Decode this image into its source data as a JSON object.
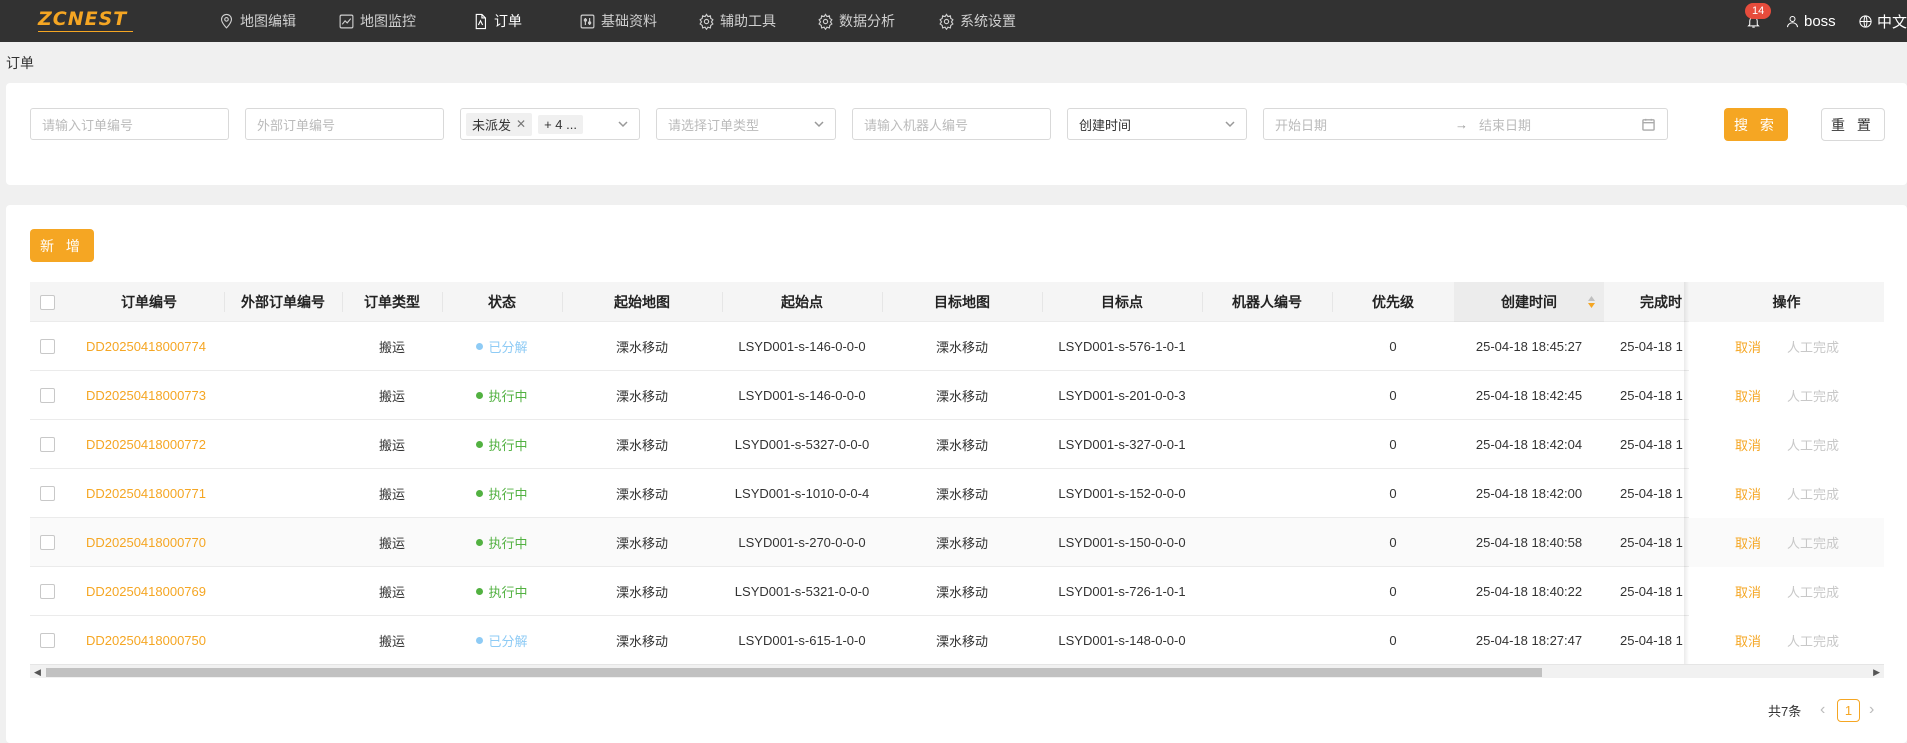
{
  "brand": {
    "logo": "ZCNEST",
    "accent": "#f5a623"
  },
  "nav": [
    {
      "label": "地图编辑",
      "icon": "map-pin-icon"
    },
    {
      "label": "地图监控",
      "icon": "chart-icon"
    },
    {
      "label": "订单",
      "icon": "document-icon",
      "active": true
    },
    {
      "label": "基础资料",
      "icon": "sliders-icon"
    },
    {
      "label": "辅助工具",
      "icon": "gear-icon"
    },
    {
      "label": "数据分析",
      "icon": "gear-icon"
    },
    {
      "label": "系统设置",
      "icon": "gear-icon"
    }
  ],
  "header_right": {
    "notification_count": "14",
    "user": "boss",
    "language": "中文"
  },
  "breadcrumb": "订单",
  "filters": {
    "order_no_placeholder": "请输入订单编号",
    "external_no_placeholder": "外部订单编号",
    "status_tag": "未派发",
    "status_more": "+ 4 ...",
    "order_type_placeholder": "请选择订单类型",
    "robot_no_placeholder": "请输入机器人编号",
    "time_field": "创建时间",
    "start_date_placeholder": "开始日期",
    "range_arrow": "→",
    "end_date_placeholder": "结束日期",
    "search_label": "搜 索",
    "reset_label": "重 置"
  },
  "add_label": "新 增",
  "columns": [
    "订单编号",
    "外部订单编号",
    "订单类型",
    "状态",
    "起始地图",
    "起始点",
    "目标地图",
    "目标点",
    "机器人编号",
    "优先级",
    "创建时间",
    "完成时",
    "操作"
  ],
  "status_colors": {
    "已分解": "#8ecbf5",
    "执行中": "#52b141"
  },
  "rows": [
    {
      "order_no": "DD20250418000774",
      "external_no": "",
      "type": "搬运",
      "status": "已分解",
      "start_map": "溧水移动",
      "start_point": "LSYD001-s-146-0-0-0",
      "target_map": "溧水移动",
      "target_point": "LSYD001-s-576-1-0-1",
      "robot": "",
      "priority": "0",
      "created": "25-04-18 18:45:27",
      "finished": "25-04-18 1",
      "cancel": "取消",
      "manual": "人工完成"
    },
    {
      "order_no": "DD20250418000773",
      "external_no": "",
      "type": "搬运",
      "status": "执行中",
      "start_map": "溧水移动",
      "start_point": "LSYD001-s-146-0-0-0",
      "target_map": "溧水移动",
      "target_point": "LSYD001-s-201-0-0-3",
      "robot": "",
      "priority": "0",
      "created": "25-04-18 18:42:45",
      "finished": "25-04-18 1",
      "cancel": "取消",
      "manual": "人工完成"
    },
    {
      "order_no": "DD20250418000772",
      "external_no": "",
      "type": "搬运",
      "status": "执行中",
      "start_map": "溧水移动",
      "start_point": "LSYD001-s-5327-0-0-0",
      "target_map": "溧水移动",
      "target_point": "LSYD001-s-327-0-0-1",
      "robot": "",
      "priority": "0",
      "created": "25-04-18 18:42:04",
      "finished": "25-04-18 1",
      "cancel": "取消",
      "manual": "人工完成"
    },
    {
      "order_no": "DD20250418000771",
      "external_no": "",
      "type": "搬运",
      "status": "执行中",
      "start_map": "溧水移动",
      "start_point": "LSYD001-s-1010-0-0-4",
      "target_map": "溧水移动",
      "target_point": "LSYD001-s-152-0-0-0",
      "robot": "",
      "priority": "0",
      "created": "25-04-18 18:42:00",
      "finished": "25-04-18 1",
      "cancel": "取消",
      "manual": "人工完成"
    },
    {
      "order_no": "DD20250418000770",
      "external_no": "",
      "type": "搬运",
      "status": "执行中",
      "start_map": "溧水移动",
      "start_point": "LSYD001-s-270-0-0-0",
      "target_map": "溧水移动",
      "target_point": "LSYD001-s-150-0-0-0",
      "robot": "",
      "priority": "0",
      "created": "25-04-18 18:40:58",
      "finished": "25-04-18 1",
      "cancel": "取消",
      "manual": "人工完成"
    },
    {
      "order_no": "DD20250418000769",
      "external_no": "",
      "type": "搬运",
      "status": "执行中",
      "start_map": "溧水移动",
      "start_point": "LSYD001-s-5321-0-0-0",
      "target_map": "溧水移动",
      "target_point": "LSYD001-s-726-1-0-1",
      "robot": "",
      "priority": "0",
      "created": "25-04-18 18:40:22",
      "finished": "25-04-18 1",
      "cancel": "取消",
      "manual": "人工完成"
    },
    {
      "order_no": "DD20250418000750",
      "external_no": "",
      "type": "搬运",
      "status": "已分解",
      "start_map": "溧水移动",
      "start_point": "LSYD001-s-615-1-0-0",
      "target_map": "溧水移动",
      "target_point": "LSYD001-s-148-0-0-0",
      "robot": "",
      "priority": "0",
      "created": "25-04-18 18:27:47",
      "finished": "25-04-18 1",
      "cancel": "取消",
      "manual": "人工完成"
    }
  ],
  "pagination": {
    "total": "共7条",
    "current": "1",
    "prev": "‹",
    "next": "›"
  }
}
